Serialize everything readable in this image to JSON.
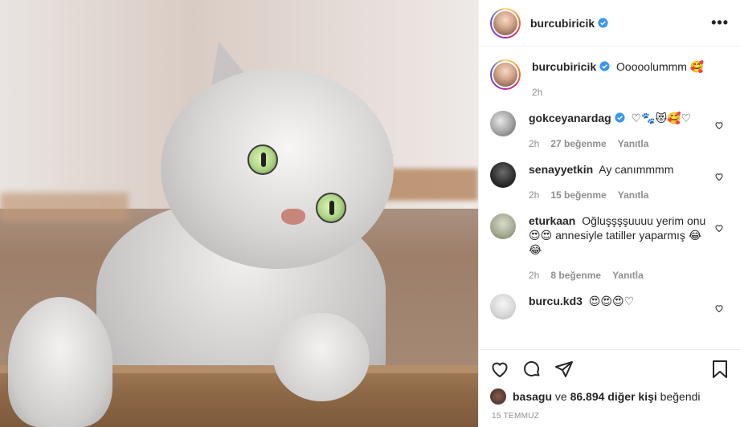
{
  "post": {
    "author": "burcubiricik",
    "caption": "Ooooolummm 🥰",
    "caption_time": "2h",
    "more_label": "•••"
  },
  "comments": [
    {
      "username": "gokceyanardag",
      "text": "♡🐾😻🥰♡",
      "time": "2h",
      "likes": "27 beğenme",
      "reply": "Yanıtla",
      "verified": true
    },
    {
      "username": "senayyetkin",
      "text": "Ay canımmmm",
      "time": "2h",
      "likes": "15 beğenme",
      "reply": "Yanıtla"
    },
    {
      "username": "eturkaan",
      "text": "Oğluşşşşuuuu yerim onu 😍😍 annesiyle tatiller yaparmış 😂😂",
      "time": "2h",
      "likes": "8 beğenme",
      "reply": "Yanıtla"
    },
    {
      "username": "burcu.kd3",
      "text": "😍😍😍♡"
    }
  ],
  "likes": {
    "liker": "basagu",
    "connector": "ve",
    "count_text": "86.894 diğer kişi",
    "suffix": "beğendi"
  },
  "date": "15 TEMMUZ",
  "colors": {
    "verified": "#3897f0",
    "text": "#262626",
    "muted": "#8e8e8e",
    "border": "#efefef"
  },
  "icons": [
    "heart-icon",
    "comment-icon",
    "share-icon",
    "bookmark-icon",
    "verified-icon",
    "more-icon"
  ]
}
